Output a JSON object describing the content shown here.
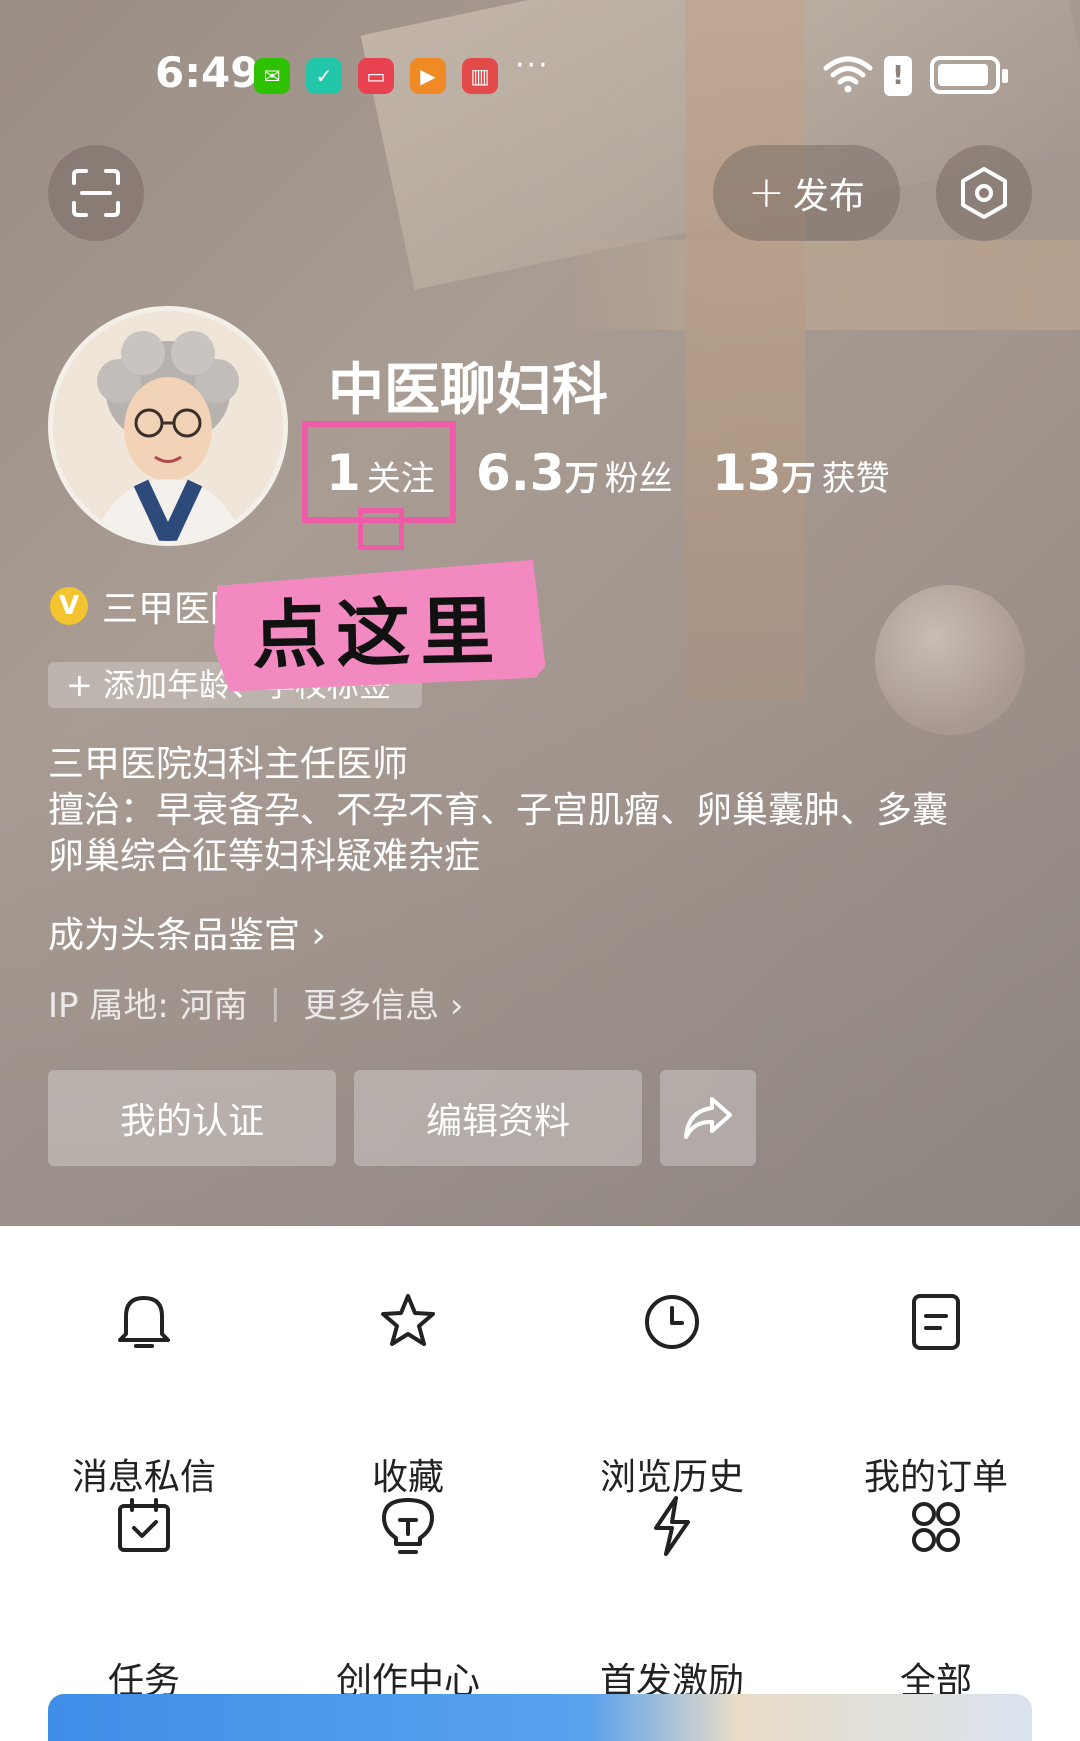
{
  "status_bar": {
    "time": "6:49",
    "more": "···"
  },
  "top_actions": {
    "publish_label": "发布"
  },
  "profile": {
    "name": "中医聊妇科",
    "stats": {
      "following": {
        "num": "1",
        "unit": "",
        "label": "关注"
      },
      "fans": {
        "num": "6.3",
        "unit": "万",
        "label": "粉丝"
      },
      "likes": {
        "num": "13",
        "unit": "万",
        "label": "获赞"
      }
    },
    "verify_text": "三甲医院",
    "add_tag": "+ 添加年龄、学校标签",
    "bio": [
      "三甲医院妇科主任医师",
      "擅治：早衰备孕、不孕不育、子宫肌瘤、卵巢囊肿、多囊",
      "卵巢综合征等妇科疑难杂症"
    ],
    "critic_link": "成为头条品鉴官 ›",
    "ip": "IP 属地: 河南",
    "more_info": "更多信息 ›"
  },
  "annotation": {
    "click_here": "点这里",
    "color": "#ee5ba6"
  },
  "actions": {
    "my_cert": "我的认证",
    "edit_profile": "编辑资料"
  },
  "menu": [
    {
      "label": "消息私信",
      "icon": "bell-icon"
    },
    {
      "label": "收藏",
      "icon": "star-icon"
    },
    {
      "label": "浏览历史",
      "icon": "clock-icon"
    },
    {
      "label": "我的订单",
      "icon": "order-icon"
    },
    {
      "label": "任务",
      "icon": "calendar-check-icon"
    },
    {
      "label": "创作中心",
      "icon": "lightbulb-icon"
    },
    {
      "label": "首发激励",
      "icon": "lightning-icon"
    },
    {
      "label": "全部",
      "icon": "grid-icon"
    }
  ]
}
